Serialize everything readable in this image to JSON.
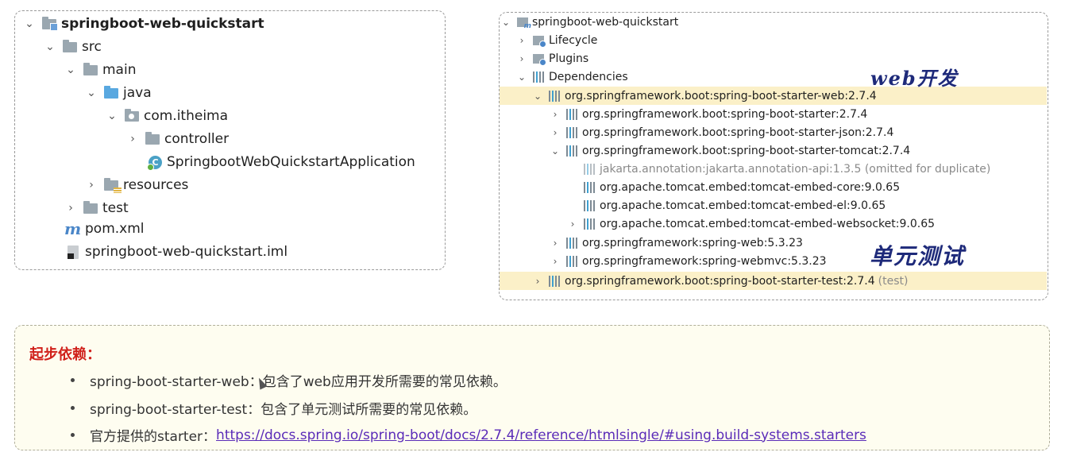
{
  "project_tree": {
    "root": "springboot-web-quickstart",
    "src": "src",
    "main": "main",
    "java": "java",
    "package": "com.itheima",
    "controller": "controller",
    "app_class": "SpringbootWebQuickstartApplication",
    "resources": "resources",
    "test": "test",
    "pom": "pom.xml",
    "iml": "springboot-web-quickstart.iml"
  },
  "maven_tree": {
    "root": "springboot-web-quickstart",
    "lifecycle": "Lifecycle",
    "plugins": "Plugins",
    "dependencies": "Dependencies",
    "items": [
      "org.springframework.boot:spring-boot-starter-web:2.7.4",
      "org.springframework.boot:spring-boot-starter:2.7.4",
      "org.springframework.boot:spring-boot-starter-json:2.7.4",
      "org.springframework.boot:spring-boot-starter-tomcat:2.7.4",
      "jakarta.annotation:jakarta.annotation-api:1.3.5 (omitted for duplicate)",
      "org.apache.tomcat.embed:tomcat-embed-core:9.0.65",
      "org.apache.tomcat.embed:tomcat-embed-el:9.0.65",
      "org.apache.tomcat.embed:tomcat-embed-websocket:9.0.65",
      "org.springframework:spring-web:5.3.23",
      "org.springframework:spring-webmvc:5.3.23",
      "org.springframework.boot:spring-boot-starter-test:2.7.4"
    ],
    "test_suffix": "(test)"
  },
  "annotations": {
    "web_dev": "web开发",
    "unit_test": "单元测试"
  },
  "notes": {
    "title": "起步依赖：",
    "bullet1": "spring-boot-starter-web：包含了web应用开发所需要的常见依赖。",
    "bullet2": "spring-boot-starter-test：包含了单元测试所需要的常见依赖。",
    "bullet3_prefix": "官方提供的starter：",
    "bullet3_link": "https://docs.spring.io/spring-boot/docs/2.7.4/reference/htmlsingle/#using.build-systems.starters"
  }
}
